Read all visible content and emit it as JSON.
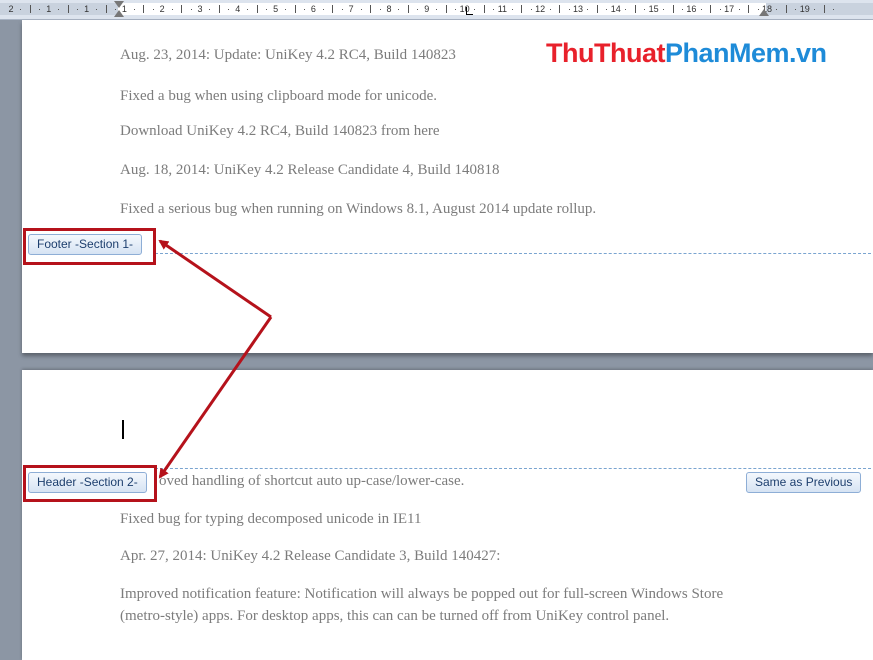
{
  "ruler": {
    "numbers": [
      "2",
      "1",
      "1",
      "1",
      "2",
      "3",
      "4",
      "5",
      "6",
      "7",
      "8",
      "9",
      "10",
      "11",
      "12",
      "13",
      "14",
      "15",
      "16",
      "17",
      "18",
      "19"
    ]
  },
  "watermark": {
    "part1": "ThuThuat",
    "part2": "PhanMem.vn"
  },
  "page1": {
    "paragraphs": [
      "Aug. 23, 2014: Update: UniKey 4.2 RC4, Build 140823",
      "Fixed a bug when using clipboard mode for unicode.",
      "Download UniKey 4.2 RC4, Build 140823 from here",
      "Aug. 18, 2014: UniKey 4.2 Release Candidate 4, Build 140818",
      "Fixed a serious bug when running on Windows 8.1, August 2014 update rollup."
    ],
    "footer_tag": "Footer -Section 1-"
  },
  "page2": {
    "header_tag": "Header -Section 2-",
    "same_as_previous": "Same as Previous",
    "partial_line": "oved handling of shortcut auto up-case/lower-case.",
    "paragraphs": [
      "Fixed bug for typing decomposed unicode in IE11",
      "Apr. 27, 2014: UniKey 4.2 Release Candidate 3, Build 140427:",
      "Improved notification feature: Notification will always be popped out for full-screen Windows Store (metro-style) apps. For desktop apps, this can can be turned off from UniKey control panel."
    ]
  },
  "colors": {
    "annotation": "#b5121b",
    "watermark_red": "#e8212b",
    "watermark_blue": "#1e8bd8",
    "boundary": "#7aa4d0"
  }
}
